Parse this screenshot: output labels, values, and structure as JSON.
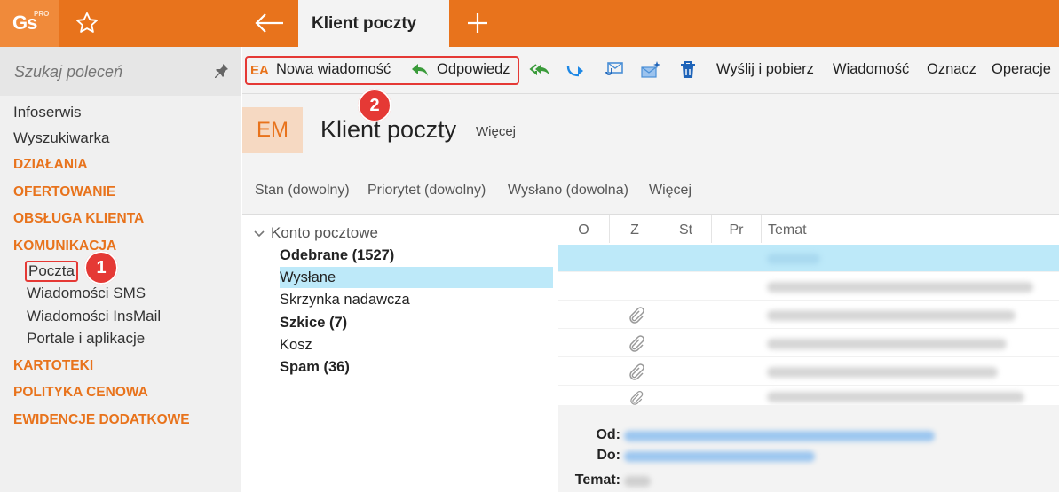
{
  "app": {
    "logo_text": "Gs",
    "logo_badge": "PRO",
    "active_tab": "Klient poczty"
  },
  "sidebar": {
    "search_placeholder": "Szukaj poleceń",
    "top_items": [
      "Infoserwis",
      "Wyszukiwarka"
    ],
    "categories": {
      "dzialania": "DZIAŁANIA",
      "ofertowanie": "OFERTOWANIE",
      "obsluga": "OBSŁUGA KLIENTA",
      "komunikacja": "KOMUNIKACJA",
      "kartoteki": "KARTOTEKI",
      "polityka": "POLITYKA CENOWA",
      "ewidencje": "EWIDENCJE DODATKOWE"
    },
    "komunikacja_items": [
      "Poczta",
      "Wiadomości SMS",
      "Wiadomości InsMail",
      "Portale i aplikacje"
    ]
  },
  "badges": {
    "one": "1",
    "two": "2"
  },
  "toolbar": {
    "ea_label": "EA",
    "new_message": "Nowa wiadomość",
    "reply": "Odpowiedz",
    "send_receive": "Wyślij i pobierz",
    "message_menu": "Wiadomość",
    "mark_menu": "Oznacz",
    "operations_menu": "Operacje"
  },
  "header": {
    "tile": "EM",
    "title": "Klient poczty",
    "more": "Więcej"
  },
  "filters": [
    "Stan (dowolny)",
    "Priorytet (dowolny)",
    "Wysłano (dowolna)",
    "Więcej"
  ],
  "folders": {
    "root": "Konto pocztowe",
    "items": [
      "Odebrane (1527)",
      "Wysłane",
      "Skrzynka nadawcza",
      "Szkice (7)",
      "Kosz",
      "Spam (36)"
    ]
  },
  "columns": [
    "O",
    "Z",
    "St",
    "Pr",
    "Temat"
  ],
  "preview": {
    "from_label": "Od:",
    "to_label": "Do:",
    "subject_label": "Temat:"
  },
  "colors": {
    "accent": "#E8731C",
    "selection": "#BDE9F9",
    "callout": "#E53935"
  }
}
